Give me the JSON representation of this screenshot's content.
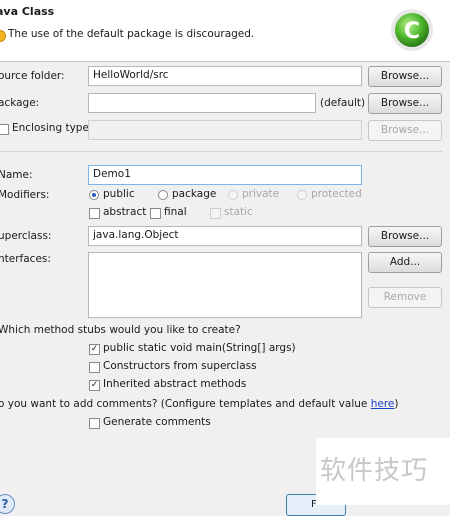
{
  "header": {
    "title": "ava Class",
    "message": "The use of the default package is discouraged.",
    "logo_letter": "C"
  },
  "source": {
    "label": "ource folder:",
    "value": "HelloWorld/src",
    "browse_label": "Browse..."
  },
  "package": {
    "label": "ackage:",
    "value": "",
    "default_label": "(default)",
    "browse_label": "Browse..."
  },
  "enclosing": {
    "label": "Enclosing type:",
    "checked": false,
    "value": "",
    "browse_label": "Browse..."
  },
  "name": {
    "label": "Name:",
    "value": "Demo1"
  },
  "modifiers": {
    "label": "Modifiers:",
    "radios": [
      {
        "label": "public",
        "selected": true,
        "enabled": true
      },
      {
        "label": "package",
        "selected": false,
        "enabled": true
      },
      {
        "label": "private",
        "selected": false,
        "enabled": false
      },
      {
        "label": "protected",
        "selected": false,
        "enabled": false
      }
    ],
    "checks": [
      {
        "label": "abstract",
        "checked": false,
        "enabled": true
      },
      {
        "label": "final",
        "checked": false,
        "enabled": true
      },
      {
        "label": "static",
        "checked": false,
        "enabled": false
      }
    ]
  },
  "superclass": {
    "label": "uperclass:",
    "value": "java.lang.Object",
    "browse_label": "Browse..."
  },
  "interfaces": {
    "label": "nterfaces:",
    "add_label": "Add...",
    "remove_label": "Remove"
  },
  "stubs": {
    "question": "Which method stubs would you like to create?",
    "options": [
      {
        "label": "public static void main(String[] args)",
        "checked": true
      },
      {
        "label": "Constructors from superclass",
        "checked": false
      },
      {
        "label": "Inherited abstract methods",
        "checked": true
      }
    ]
  },
  "comments": {
    "question": "o you want to add comments? (Configure templates and default value ",
    "link": "here",
    "suffix": ")",
    "option_label": "Generate comments",
    "option_checked": false
  },
  "footer": {
    "help_symbol": "?",
    "finish_partial": "F"
  },
  "watermark": {
    "text": "软件技巧"
  }
}
